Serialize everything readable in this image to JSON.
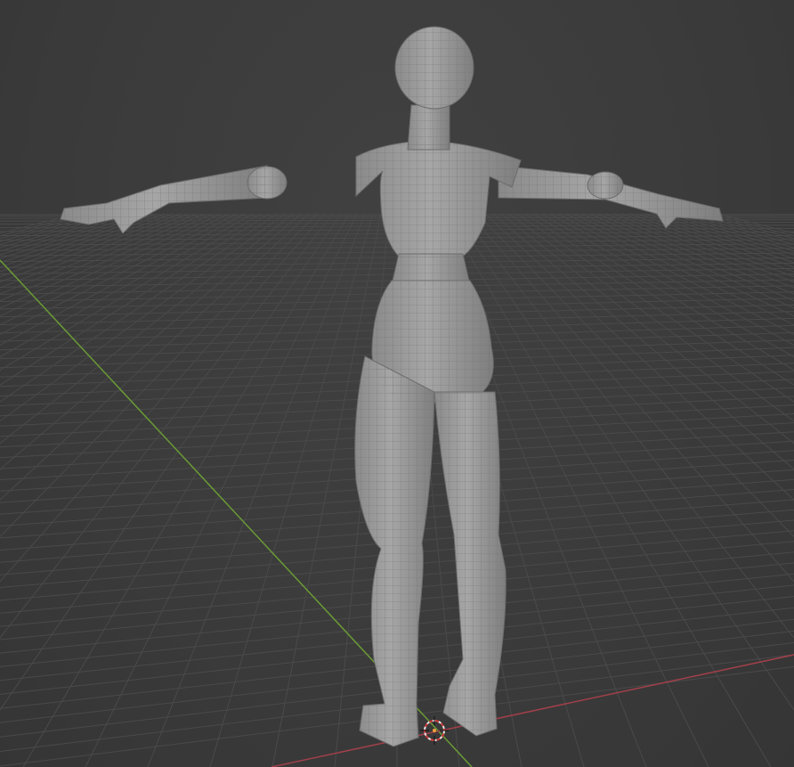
{
  "viewport": {
    "mode": "3D Viewport",
    "shading": "wireframe-overlay-solid",
    "background_color": "#3d3d3d",
    "grid_color": "#4a4a4a",
    "x_axis_color": "#a0404a",
    "y_axis_color": "#6a9a35",
    "mesh_color": "#9c9c9c"
  },
  "scene": {
    "object": "humanoid-mesh",
    "pose": "t-pose",
    "view": "back"
  },
  "icons": {
    "cursor": "3d-cursor-icon"
  }
}
